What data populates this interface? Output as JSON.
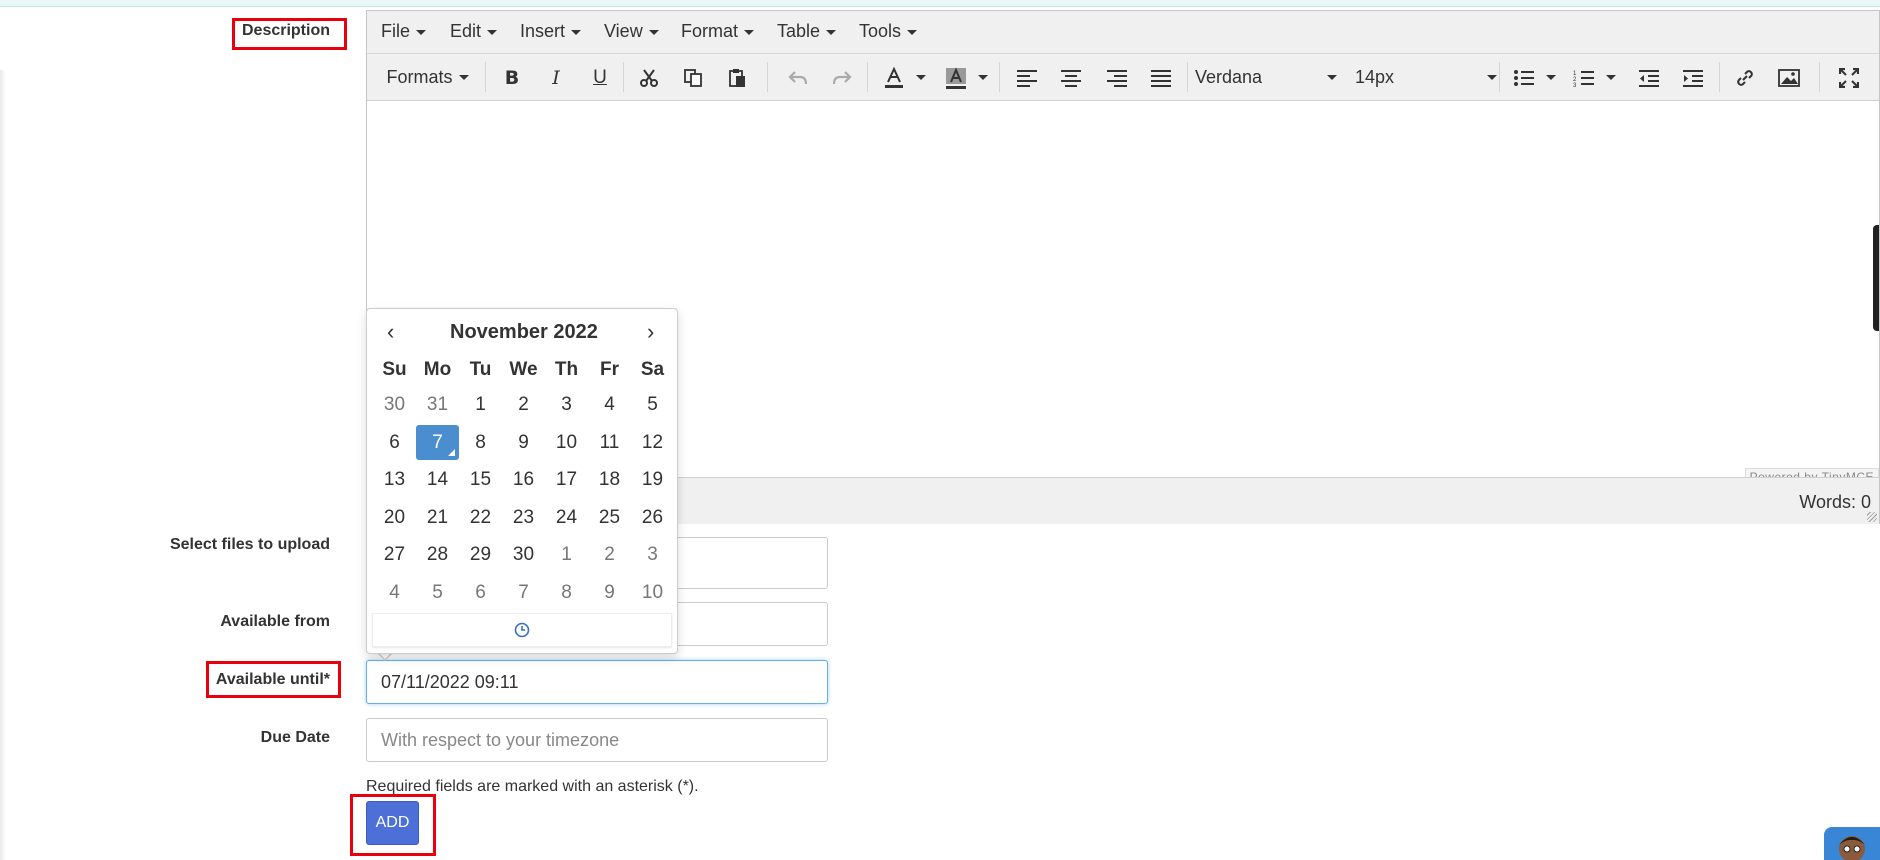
{
  "form": {
    "description_label": "Description",
    "files_label": "Select files to upload",
    "available_from_label": "Available from",
    "available_until_label": "Available until*",
    "available_until_value": "07/11/2022 09:11",
    "due_date_label": "Due Date",
    "due_date_placeholder": "With respect to your timezone",
    "required_note": "Required fields are marked with an asterisk (*).",
    "add_label": "ADD"
  },
  "editor": {
    "menus": [
      "File",
      "Edit",
      "Insert",
      "View",
      "Format",
      "Table",
      "Tools"
    ],
    "formats_label": "Formats",
    "font_family": "Verdana",
    "font_size": "14px",
    "powered_by": "Powered by TinyMCE",
    "words": "Words: 0"
  },
  "datepicker": {
    "month_year": "November 2022",
    "prev": "‹",
    "next": "›",
    "weekdays": [
      "Su",
      "Mo",
      "Tu",
      "We",
      "Th",
      "Fr",
      "Sa"
    ],
    "weeks": [
      [
        "30",
        "31",
        "1",
        "2",
        "3",
        "4",
        "5"
      ],
      [
        "6",
        "7",
        "8",
        "9",
        "10",
        "11",
        "12"
      ],
      [
        "13",
        "14",
        "15",
        "16",
        "17",
        "18",
        "19"
      ],
      [
        "20",
        "21",
        "22",
        "23",
        "24",
        "25",
        "26"
      ],
      [
        "27",
        "28",
        "29",
        "30",
        "1",
        "2",
        "3"
      ],
      [
        "4",
        "5",
        "6",
        "7",
        "8",
        "9",
        "10"
      ]
    ],
    "selected": "7",
    "clock_icon": "clock-icon"
  },
  "colors": {
    "highlight": "#e8000d",
    "add_button": "#4c6fd8",
    "selected_day": "#4a8ecf"
  }
}
